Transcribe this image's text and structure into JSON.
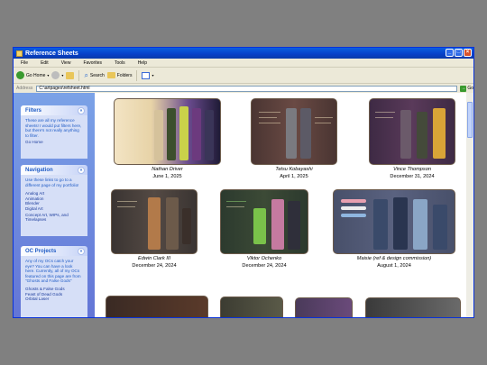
{
  "window": {
    "title": "Reference Sheets"
  },
  "menu": [
    "File",
    "Edit",
    "View",
    "Favorites",
    "Tools",
    "Help"
  ],
  "toolbar": {
    "back": "Go Home",
    "search": "Search",
    "folders": "Folders"
  },
  "address": {
    "label": "Address",
    "value": "C:\\artpages\\refsheet.html",
    "go": "Go"
  },
  "sidebar": {
    "filters": {
      "title": "Filters",
      "text": "These are all my reference sheets! I would put filters here, but there's not really anything to filter.",
      "link": "Go Home"
    },
    "navigation": {
      "title": "Navigation",
      "text": "Use these links to go to a different page of my portfolio!",
      "links": [
        "Analog Art",
        "Animation",
        "Blender",
        "Digital Art",
        "Concept Art, WIPs, and Timelapses"
      ]
    },
    "oc": {
      "title": "OC Projects",
      "text": "Any of my OCs catch your eye? You can have a look here. Currently, all of my OCs featured on this page are from \"Ghosts and False Gods\"",
      "links": [
        "Ghosts & False Gods",
        "Feast of Dead Gods",
        "Orbital Laser"
      ]
    }
  },
  "cards": [
    {
      "name": "Nathan Driver",
      "date": "June 1, 2025"
    },
    {
      "name": "Tetsu Kobayashi",
      "date": "April 1, 2025"
    },
    {
      "name": "Vince Thompson",
      "date": "December 31, 2024"
    },
    {
      "name": "Edwin Clark III",
      "date": "December 24, 2024"
    },
    {
      "name": "Viktor Ochenko",
      "date": "December 24, 2024"
    },
    {
      "name": "Maisie (ref & design commission)",
      "date": "August 1, 2024"
    }
  ],
  "colors": {
    "titlebar": "#0a5fe0",
    "sidebar": "#6f8edf",
    "panel": "#d6dff7"
  }
}
